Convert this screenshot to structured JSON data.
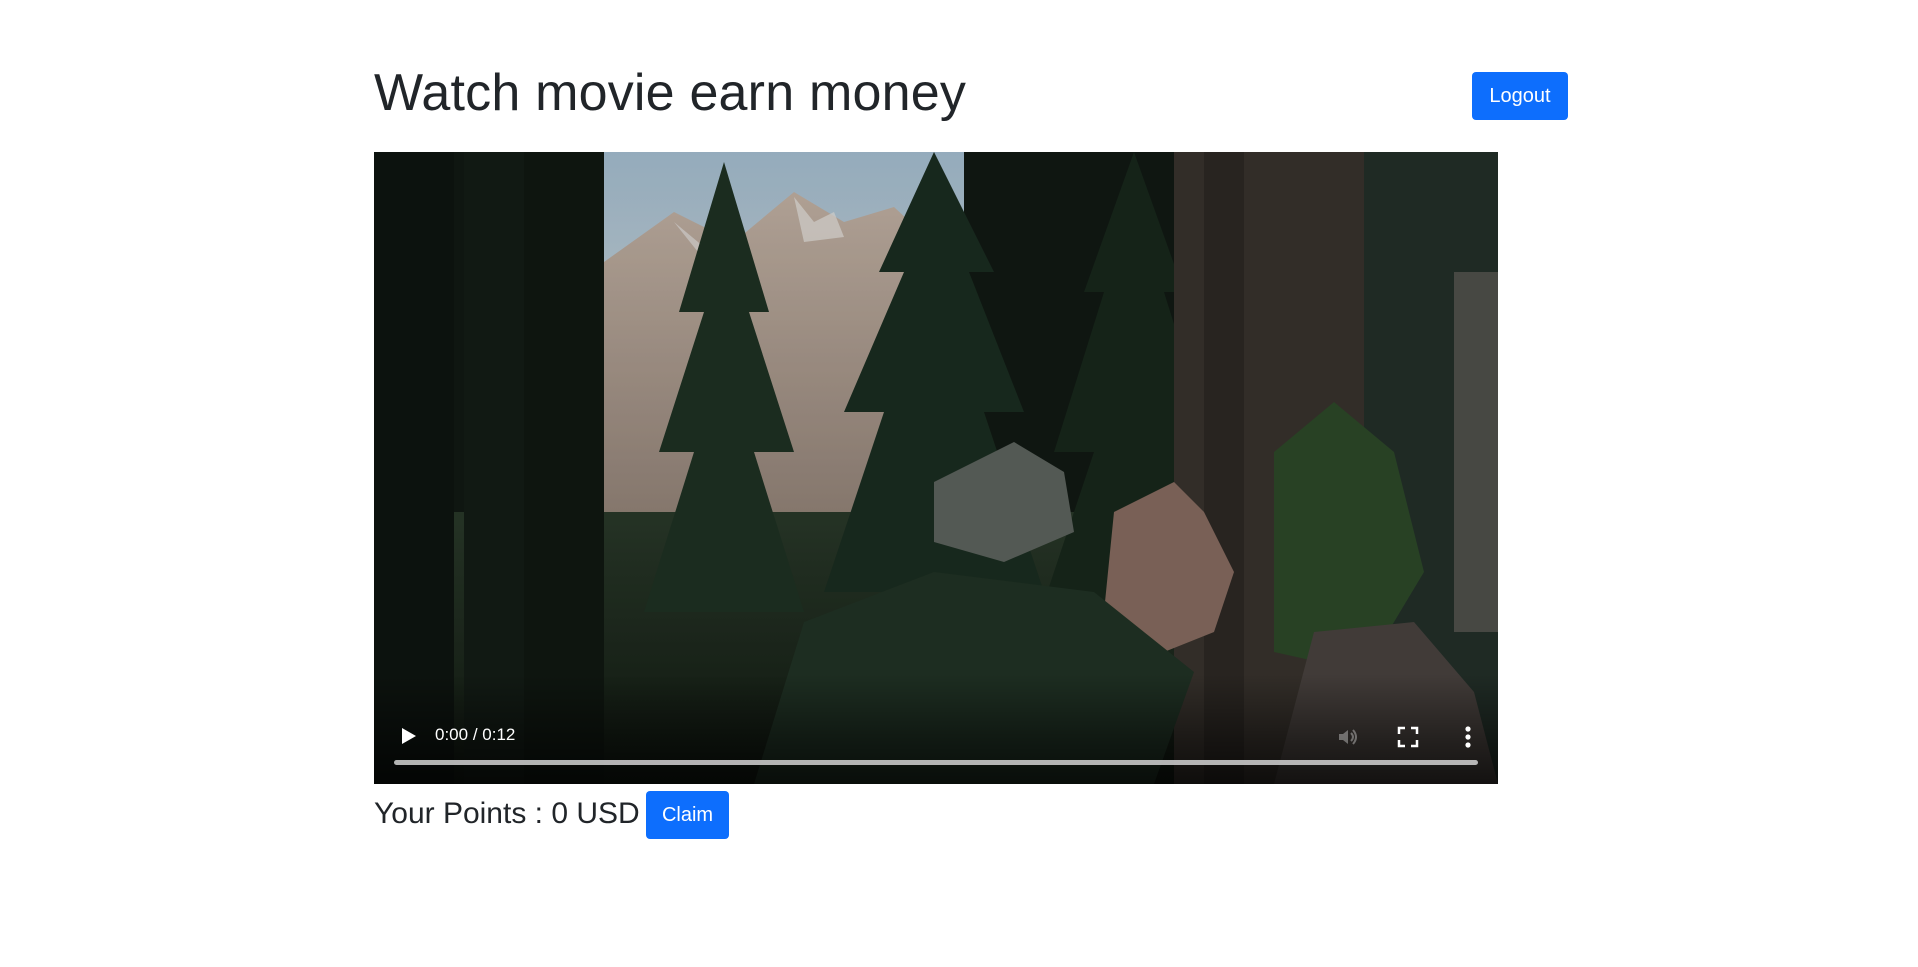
{
  "header": {
    "title": "Watch movie earn money",
    "logout_label": "Logout"
  },
  "video": {
    "time_current": "0:00",
    "time_separator": " / ",
    "time_total": "0:12",
    "progress_fraction": 0,
    "icons": {
      "play": "play-icon",
      "mute": "volume-icon",
      "fullscreen": "fullscreen-icon",
      "more": "more-vertical-icon"
    }
  },
  "points": {
    "label": "Your Points : 0 USD",
    "claim_label": "Claim"
  },
  "colors": {
    "primary": "#0d6efd",
    "text": "#212529",
    "background": "#ffffff"
  }
}
